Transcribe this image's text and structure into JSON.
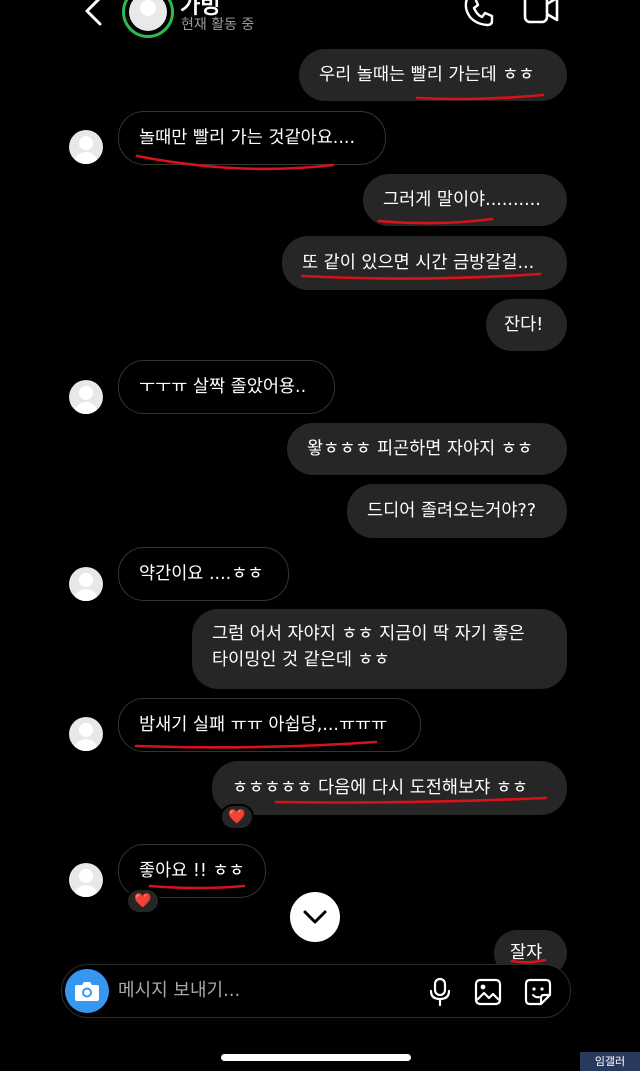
{
  "header": {
    "contact_name": "가빙",
    "status": "현재 활동 중"
  },
  "messages": [
    {
      "side": "out",
      "text": "우리 놀때는 빨리 가는데 ㅎㅎ"
    },
    {
      "side": "in",
      "text": "놀때만 빨리 가는 것같아요...."
    },
    {
      "side": "out",
      "text": "그러게 말이야.........."
    },
    {
      "side": "out",
      "text": "또 같이 있으면 시간 금방갈걸..."
    },
    {
      "side": "out",
      "text": "잔다!"
    },
    {
      "side": "in",
      "text": "ㅜㅜㅠ 살짝 졸았어용.."
    },
    {
      "side": "out",
      "text": "왛ㅎㅎㅎ 피곤하면 자야지 ㅎㅎ"
    },
    {
      "side": "out",
      "text": "드디어 졸려오는거야??"
    },
    {
      "side": "in",
      "text": "약간이요 ....ㅎㅎ"
    },
    {
      "side": "out",
      "text": "그럼 어서 자야지 ㅎㅎ 지금이 딱 자기 좋은\n타이밍인 것 같은데 ㅎㅎ"
    },
    {
      "side": "in",
      "text": "밤새기 실패 ㅠㅠ 아쉽당,...ㅠㅠㅠ"
    },
    {
      "side": "out",
      "text": "ㅎㅎㅎㅎㅎ 다음에 다시 도전해보쟈 ㅎㅎ",
      "reaction": "❤️"
    },
    {
      "side": "in",
      "text": "좋아요 !! ㅎㅎ",
      "reaction": "❤️"
    },
    {
      "side": "out",
      "text": "잘쟈"
    }
  ],
  "composer": {
    "placeholder": "메시지 보내기..."
  },
  "watermark": "임갤러",
  "colors": {
    "accent": "#3797f0",
    "active_ring": "#2dbb4f",
    "annotation_red": "#d8121b",
    "outgoing_bubble": "#262626"
  }
}
